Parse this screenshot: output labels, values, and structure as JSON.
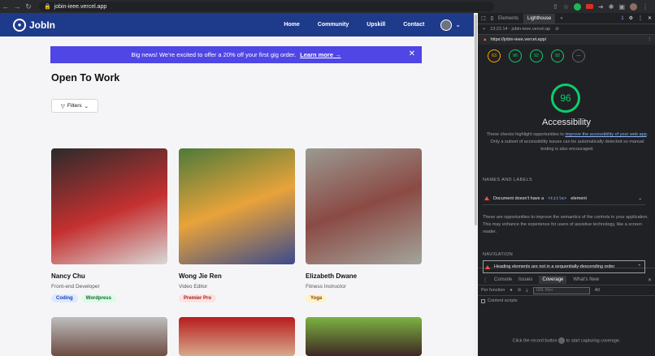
{
  "browser": {
    "url": "jobin-ieee.vercel.app"
  },
  "site": {
    "logo_text": "JobIn",
    "nav": [
      "Home",
      "Community",
      "Upskill",
      "Contact"
    ]
  },
  "banner": {
    "text": "Big news! We're excited to offer a 20% off your first gig order.",
    "link": "Learn more →",
    "close": "✕"
  },
  "page": {
    "title": "Open To Work",
    "filters_label": "Filters"
  },
  "profiles": [
    {
      "name": "Nancy Chu",
      "role": "Front-end Developer",
      "tags": [
        "Coding",
        "Wordpress"
      ]
    },
    {
      "name": "Wong Jie Ren",
      "role": "Video Editor",
      "tags": [
        "Premier Pro"
      ]
    },
    {
      "name": "Elizabeth Dwane",
      "role": "Fitness Instructor",
      "tags": [
        "Yoga"
      ]
    }
  ],
  "devtools": {
    "tabs": [
      "Elements",
      "Lighthouse"
    ],
    "issues_count": "1",
    "report_time": "13:21:14 - jobin-ieee.vercel.ap",
    "audited_url": "https://jobin-ieee.vercel.app/",
    "scores": [
      "63",
      "96",
      "92",
      "92"
    ],
    "main_score": "96",
    "category": "Accessibility",
    "desc_pre": "These checks highlight opportunities to",
    "desc_link": "improve the accessibility of your web app",
    "desc_post": ". Only a subset of accessibility issues can be automatically detected so manual testing is also encouraged.",
    "section1": "NAMES AND LABELS",
    "audit1_pre": "Document doesn't have a",
    "audit1_code": "<title>",
    "audit1_post": "element",
    "note": "These are opportunities to improve the semantics of the controls in your application. This may enhance the experience for users of assistive technology, like a screen reader.",
    "section2": "NAVIGATION",
    "audit2": "Heading elements are not in a sequentially-descending order",
    "drawer_tabs": [
      "Console",
      "Issues",
      "Coverage",
      "What's New"
    ],
    "per_function": "Per function",
    "url_filter_placeholder": "URL filter",
    "all_label": "All",
    "content_scripts": "Content scripts",
    "record_pre": "Click the record button",
    "record_post": "to start capturing coverage."
  }
}
